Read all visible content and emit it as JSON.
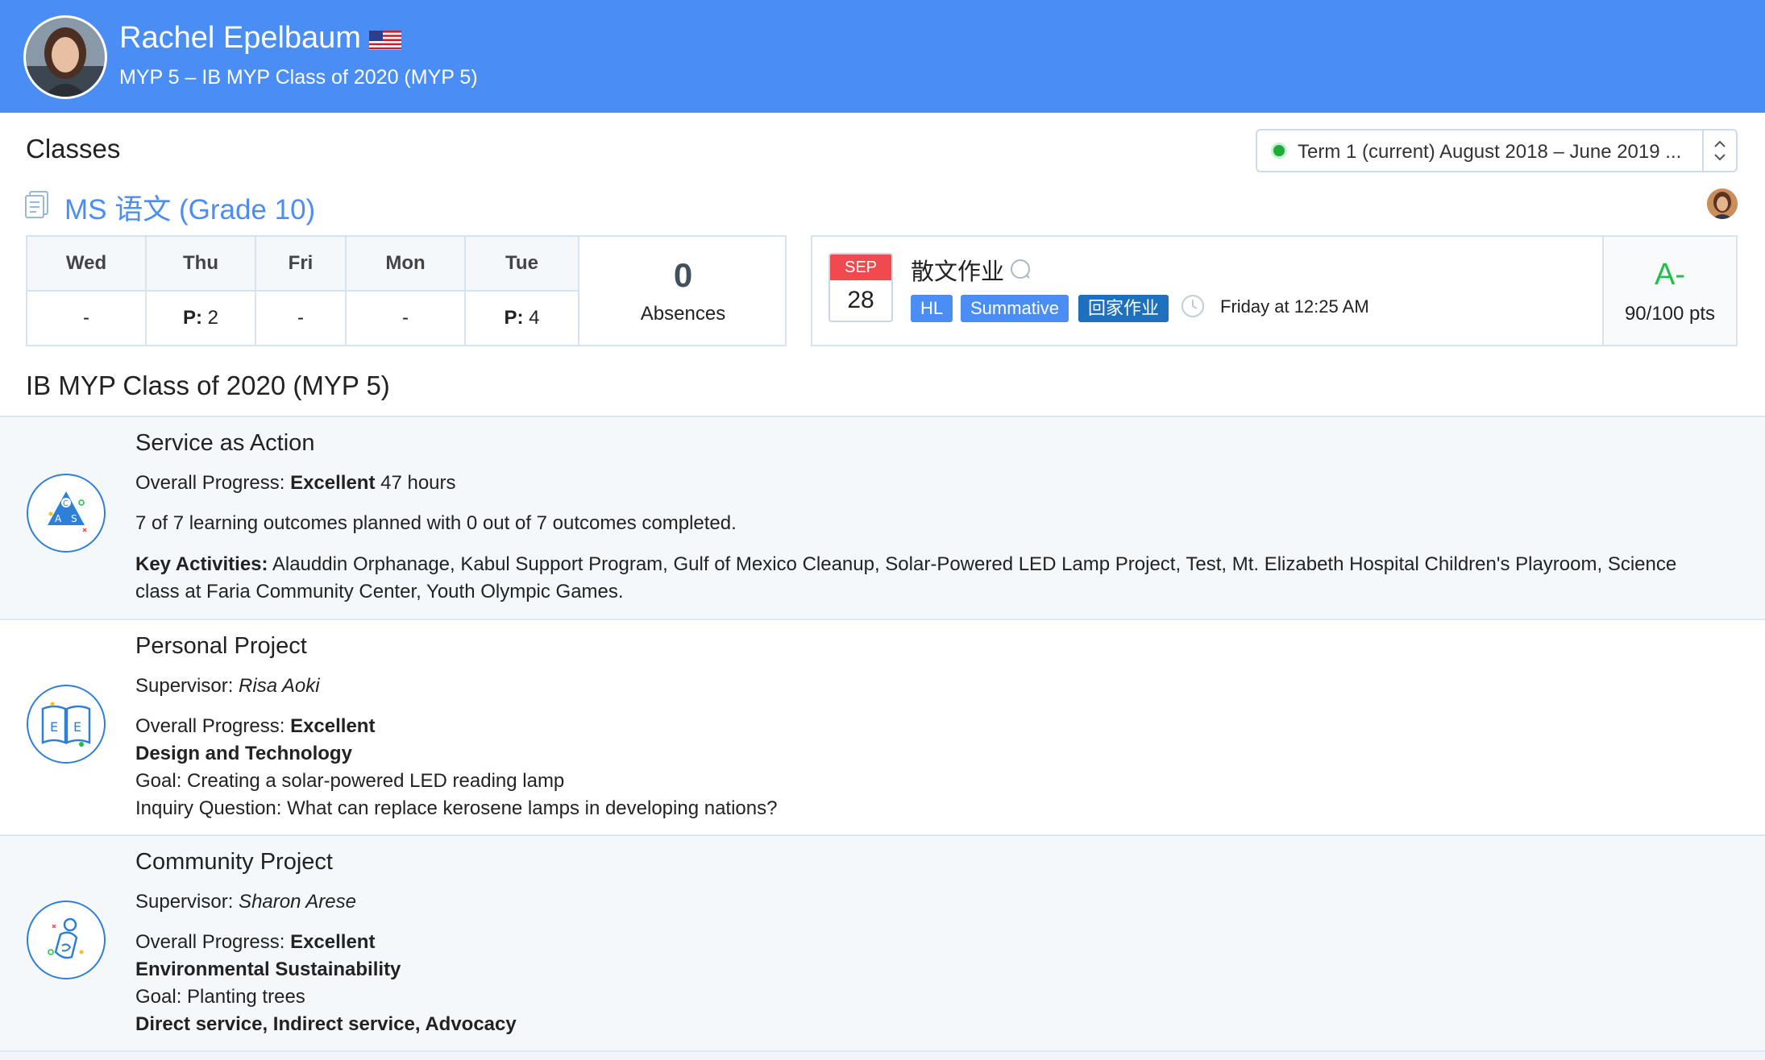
{
  "student": {
    "name": "Rachel Epelbaum",
    "subtitle": "MYP 5 – IB MYP Class of 2020 (MYP 5)",
    "flag_icon": "us-flag-icon"
  },
  "classes": {
    "title": "Classes",
    "term_select": {
      "label": "Term 1 (current) August 2018 – June 2019 ...",
      "status_color": "#1faa3b"
    },
    "class_name": "MS 语文 (Grade 10)",
    "attendance": {
      "days": [
        {
          "day": "Wed",
          "prefix": "",
          "value": "-"
        },
        {
          "day": "Thu",
          "prefix": "P:",
          "value": " 2"
        },
        {
          "day": "Fri",
          "prefix": "",
          "value": "-"
        },
        {
          "day": "Mon",
          "prefix": "",
          "value": "-"
        },
        {
          "day": "Tue",
          "prefix": "P:",
          "value": " 4"
        }
      ],
      "absences_count": "0",
      "absences_label": "Absences"
    },
    "assignment": {
      "month": "SEP",
      "day": "28",
      "title": "散文作业",
      "tags": [
        {
          "label": "HL",
          "color": "#4a8ef5"
        },
        {
          "label": "Summative",
          "color": "#4a8ef5"
        },
        {
          "label": "回家作业",
          "color": "#1f6fbf"
        }
      ],
      "due": "Friday at 12:25 AM",
      "grade": "A-",
      "points": "90/100 pts"
    }
  },
  "programme": {
    "title": "IB MYP Class of 2020 (MYP 5)",
    "service": {
      "heading": "Service as Action",
      "progress_label": "Overall Progress:",
      "progress_value": "Excellent",
      "progress_extra": " 47 hours",
      "outcomes": "7 of 7 learning outcomes planned with 0 out of 7 outcomes completed.",
      "activities_label": "Key Activities:",
      "activities": " Alauddin Orphanage, Kabul Support Program, Gulf of Mexico Cleanup, Solar-Powered LED Lamp Project, Test, Mt. Elizabeth Hospital Children's Playroom, Science class at Faria Community Center, Youth Olympic Games."
    },
    "personal": {
      "heading": "Personal Project",
      "supervisor_label": "Supervisor:",
      "supervisor": " Risa Aoki",
      "progress_label": "Overall Progress:",
      "progress_value": "Excellent",
      "topic": "Design and Technology",
      "goal": "Goal: Creating a solar-powered LED reading lamp",
      "inquiry": "Inquiry Question: What can replace kerosene lamps in developing nations?"
    },
    "community": {
      "heading": "Community Project",
      "supervisor_label": "Supervisor:",
      "supervisor": " Sharon Arese",
      "progress_label": "Overall Progress:",
      "progress_value": "Excellent",
      "topic": "Environmental Sustainability",
      "goal": "Goal: Planting trees",
      "service_types": "Direct service, Indirect service, Advocacy"
    }
  }
}
